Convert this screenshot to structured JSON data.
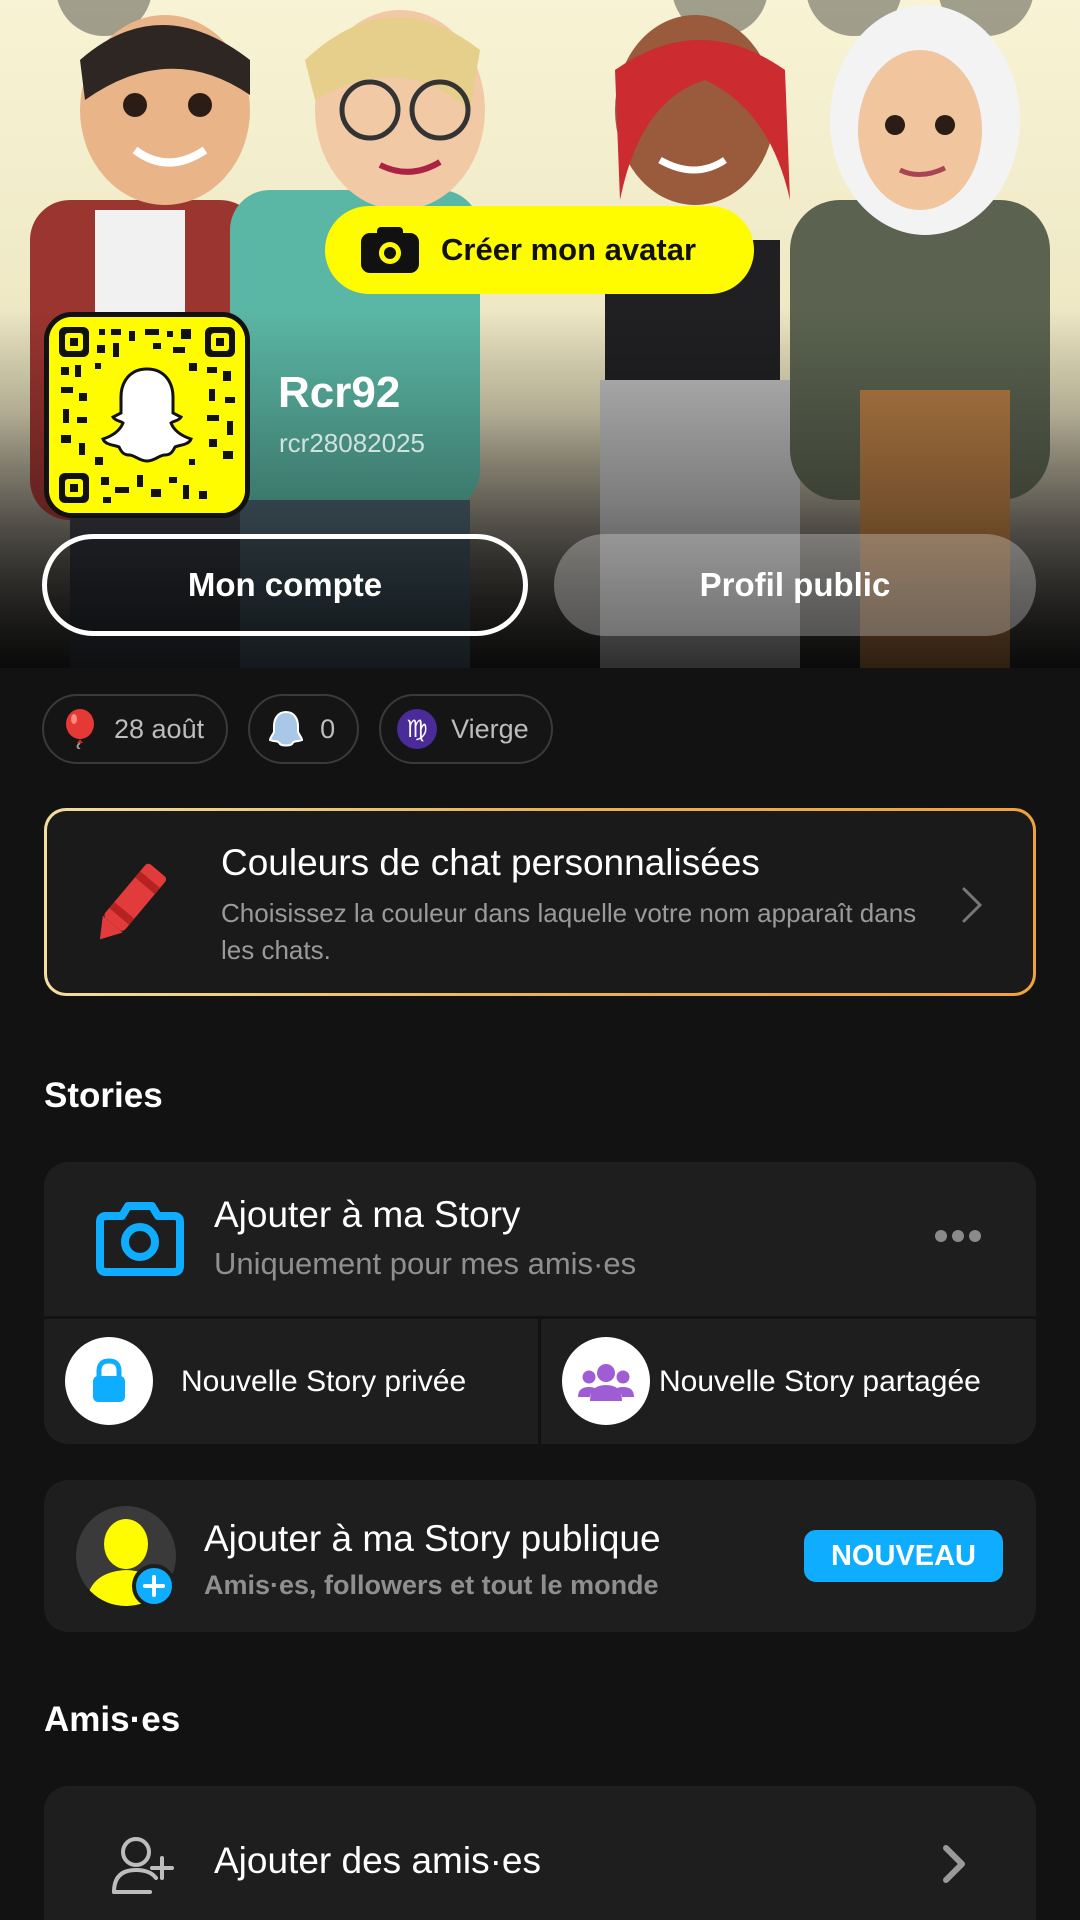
{
  "hero": {
    "create_avatar_label": "Créer mon avatar",
    "display_name": "Rcr92",
    "username": "rcr28082025",
    "my_account_label": "Mon compte",
    "public_profile_label": "Profil public"
  },
  "chips": {
    "birthday": "28 août",
    "snapscore": "0",
    "zodiac": "Vierge"
  },
  "promo": {
    "title": "Couleurs de chat personnalisées",
    "description": "Choisissez la couleur dans laquelle votre nom apparaît dans les chats."
  },
  "stories": {
    "section_title": "Stories",
    "add_story_title": "Ajouter à ma Story",
    "add_story_sub": "Uniquement pour mes amis·es",
    "private_story": "Nouvelle Story privée",
    "shared_story": "Nouvelle Story partagée"
  },
  "public_story": {
    "title": "Ajouter à ma Story publique",
    "subtitle": "Amis·es, followers et tout le monde",
    "badge": "NOUVEAU"
  },
  "friends": {
    "section_title": "Amis·es",
    "add_friends": "Ajouter des amis·es"
  },
  "colors": {
    "snap_yellow": "#fffc00",
    "badge_blue": "#0fadff",
    "background": "#121212",
    "card": "#1e1e1e"
  },
  "icons": [
    "camera-icon",
    "balloon-icon",
    "ghost-icon",
    "virgo-icon",
    "crayon-icon",
    "chevron-right-icon",
    "more-icon",
    "lock-icon",
    "group-icon",
    "add-friend-icon"
  ]
}
